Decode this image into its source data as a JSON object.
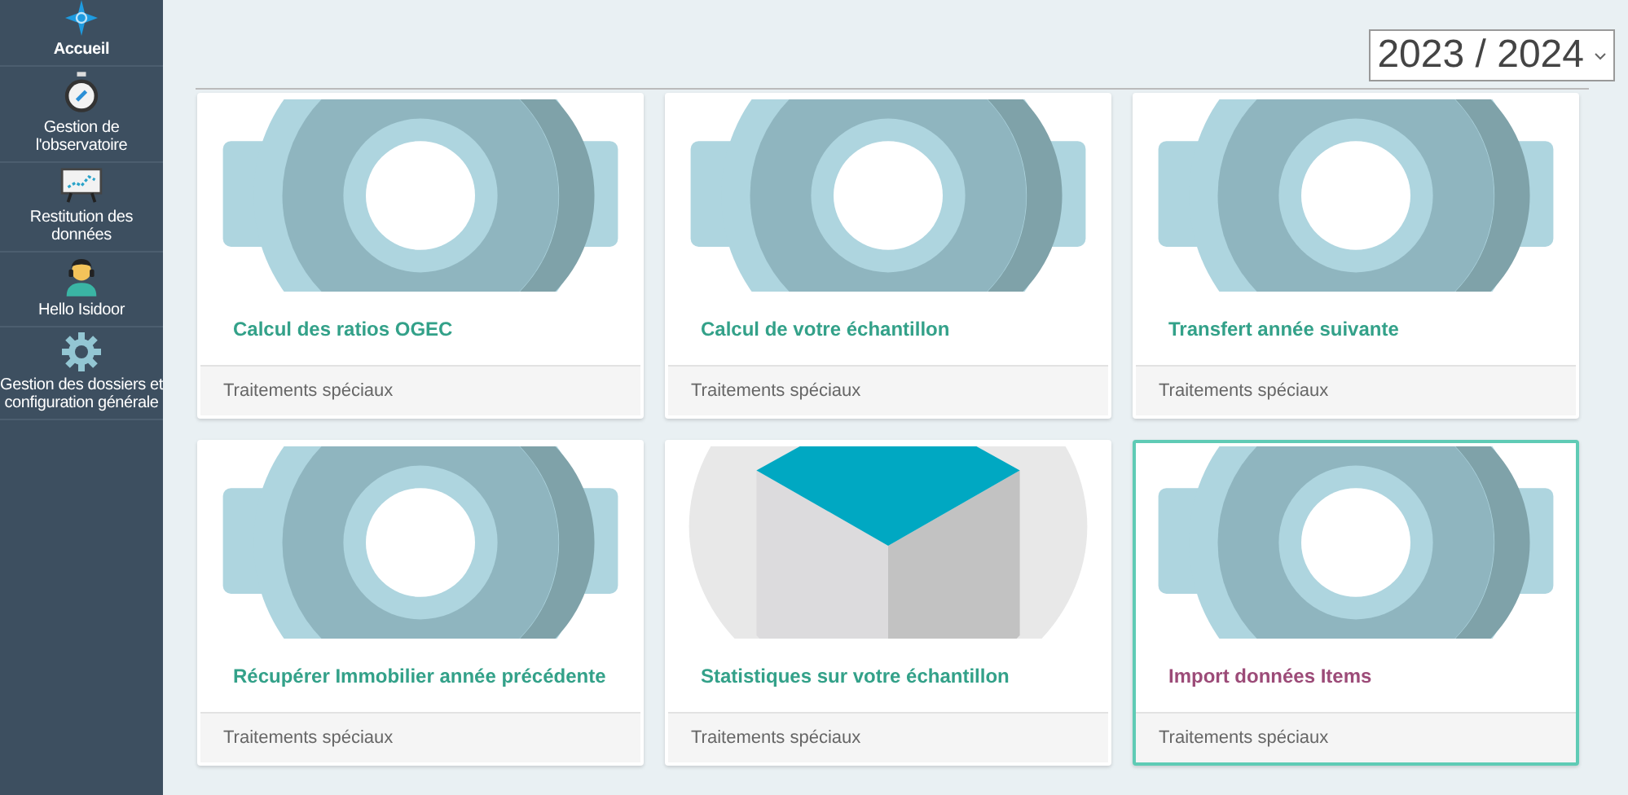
{
  "sidebar": {
    "items": [
      {
        "label": "Accueil",
        "kind": "star",
        "selected": true
      },
      {
        "label": "Gestion de l'observatoire",
        "kind": "stopwatch",
        "selected": false
      },
      {
        "label": "Restitution des données",
        "kind": "chart",
        "selected": false
      },
      {
        "label": "Hello Isidoor",
        "kind": "person",
        "selected": false
      },
      {
        "label": "Gestion des dossiers et configuration générale",
        "kind": "gear",
        "selected": false
      }
    ]
  },
  "year_select": {
    "value": "2023 / 2024"
  },
  "cards": [
    {
      "title": "Calcul des ratios OGEC",
      "footer": "Traitements spéciaux",
      "kind": "gear",
      "selected": false
    },
    {
      "title": "Calcul de votre échantillon",
      "footer": "Traitements spéciaux",
      "kind": "gear",
      "selected": false
    },
    {
      "title": "Transfert année suivante",
      "footer": "Traitements spéciaux",
      "kind": "gear",
      "selected": false
    },
    {
      "title": "Récupérer Immobilier année précédente",
      "footer": "Traitements spéciaux",
      "kind": "gear",
      "selected": false
    },
    {
      "title": "Statistiques sur votre échantillon",
      "footer": "Traitements spéciaux",
      "kind": "box",
      "selected": false
    },
    {
      "title": "Import données Items",
      "footer": "Traitements spéciaux",
      "kind": "gear",
      "selected": true
    }
  ]
}
